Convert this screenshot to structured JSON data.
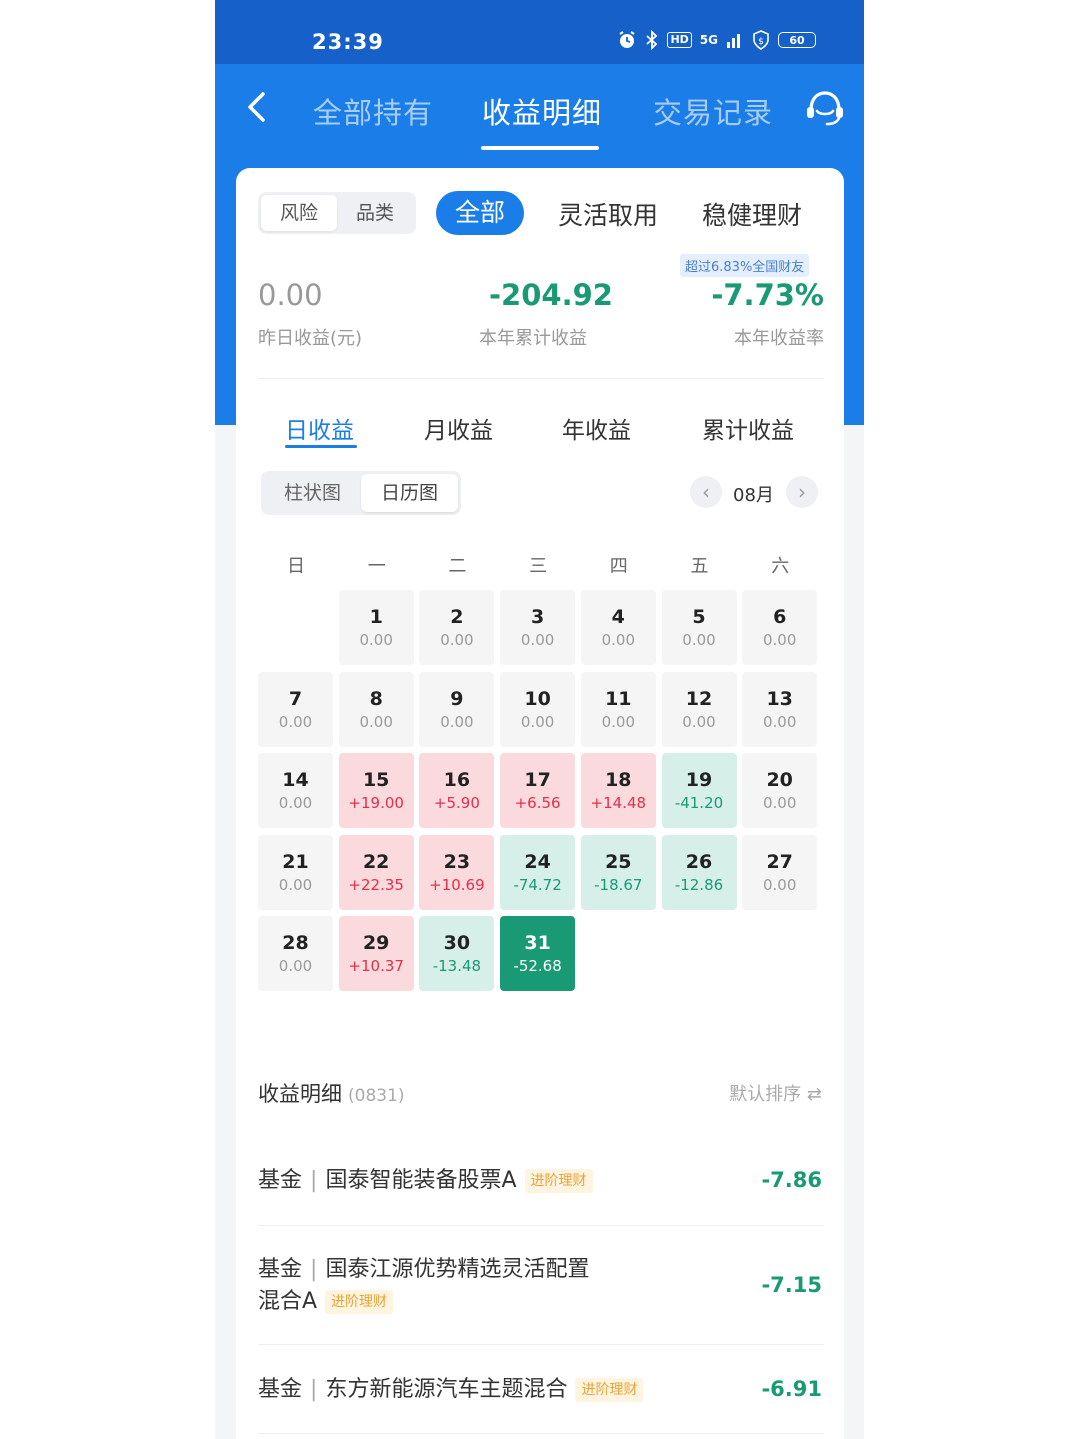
{
  "status_bar": {
    "time": "23:39",
    "battery": "60",
    "network": "5G"
  },
  "nav": {
    "tabs": [
      {
        "label": "全部持有"
      },
      {
        "label": "收益明细"
      },
      {
        "label": "交易记录"
      }
    ]
  },
  "filters": {
    "segment": [
      "风险",
      "品类"
    ],
    "tabs": [
      "全部",
      "灵活取用",
      "稳健理财"
    ]
  },
  "summary": {
    "rank_badge": "超过6.83%全国财友",
    "yesterday": {
      "value": "0.00",
      "label": "昨日收益(元)"
    },
    "year_total": {
      "value": "-204.92",
      "label": "本年累计收益"
    },
    "year_rate": {
      "value": "-7.73%",
      "label": "本年收益率"
    }
  },
  "period_tabs": [
    "日收益",
    "月收益",
    "年收益",
    "累计收益"
  ],
  "view_toggle": [
    "柱状图",
    "日历图"
  ],
  "month": "08月",
  "calendar": {
    "weekdays": [
      "日",
      "一",
      "二",
      "三",
      "四",
      "五",
      "六"
    ],
    "days": [
      {
        "d": "1",
        "v": "0.00"
      },
      {
        "d": "2",
        "v": "0.00"
      },
      {
        "d": "3",
        "v": "0.00"
      },
      {
        "d": "4",
        "v": "0.00"
      },
      {
        "d": "5",
        "v": "0.00"
      },
      {
        "d": "6",
        "v": "0.00"
      },
      {
        "d": "7",
        "v": "0.00"
      },
      {
        "d": "8",
        "v": "0.00"
      },
      {
        "d": "9",
        "v": "0.00"
      },
      {
        "d": "10",
        "v": "0.00"
      },
      {
        "d": "11",
        "v": "0.00"
      },
      {
        "d": "12",
        "v": "0.00"
      },
      {
        "d": "13",
        "v": "0.00"
      },
      {
        "d": "14",
        "v": "0.00"
      },
      {
        "d": "15",
        "v": "+19.00"
      },
      {
        "d": "16",
        "v": "+5.90"
      },
      {
        "d": "17",
        "v": "+6.56"
      },
      {
        "d": "18",
        "v": "+14.48"
      },
      {
        "d": "19",
        "v": "-41.20"
      },
      {
        "d": "20",
        "v": "0.00"
      },
      {
        "d": "21",
        "v": "0.00"
      },
      {
        "d": "22",
        "v": "+22.35"
      },
      {
        "d": "23",
        "v": "+10.69"
      },
      {
        "d": "24",
        "v": "-74.72"
      },
      {
        "d": "25",
        "v": "-18.67"
      },
      {
        "d": "26",
        "v": "-12.86"
      },
      {
        "d": "27",
        "v": "0.00"
      },
      {
        "d": "28",
        "v": "0.00"
      },
      {
        "d": "29",
        "v": "+10.37"
      },
      {
        "d": "30",
        "v": "-13.48"
      },
      {
        "d": "31",
        "v": "-52.68"
      }
    ]
  },
  "details": {
    "title": "收益明细",
    "date": "(0831)",
    "sort": "默认排序 ⇄",
    "items": [
      {
        "category": "基金",
        "name": "国泰智能装备股票A",
        "tag": "进阶理财",
        "value": "-7.86"
      },
      {
        "category": "基金",
        "name_line1": "国泰江源优势精选灵活配置",
        "name_line2": "混合A",
        "tag": "进阶理财",
        "value": "-7.15"
      },
      {
        "category": "基金",
        "name": "东方新能源汽车主题混合",
        "tag": "进阶理财",
        "value": "-6.91"
      }
    ]
  },
  "colors": {
    "brand_blue": "#1a7de8",
    "gain_red": "#e0304a",
    "loss_green": "#1a9a74"
  }
}
